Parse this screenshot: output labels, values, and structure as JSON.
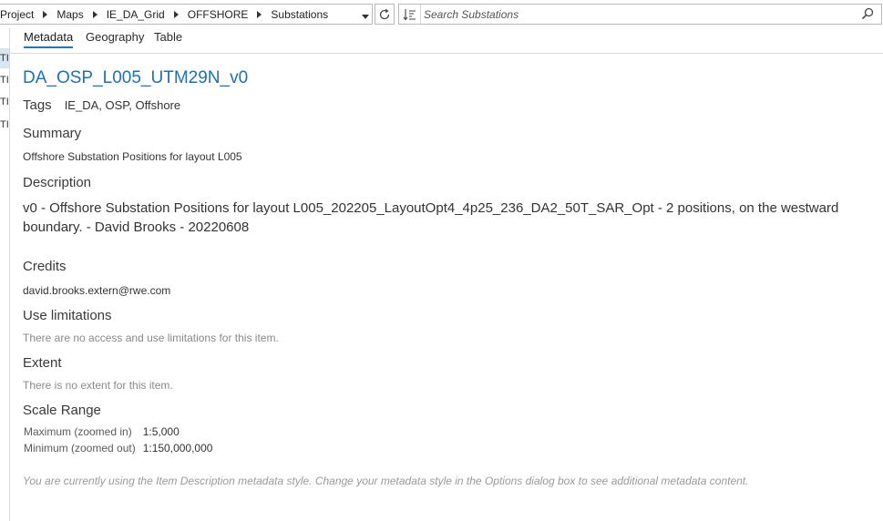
{
  "breadcrumb": {
    "items": [
      "Project",
      "Maps",
      "IE_DA_Grid",
      "OFFSHORE",
      "Substations"
    ]
  },
  "search": {
    "placeholder": "Search Substations"
  },
  "left_strip": {
    "items": [
      "TI",
      "TI",
      "TI",
      "TI"
    ]
  },
  "tabs": [
    {
      "label": "Metadata",
      "active": true
    },
    {
      "label": "Geography",
      "active": false
    },
    {
      "label": "Table",
      "active": false
    }
  ],
  "metadata": {
    "title": "DA_OSP_L005_UTM29N_v0",
    "tags_label": "Tags",
    "tags_value": "IE_DA, OSP, Offshore",
    "summary_label": "Summary",
    "summary_value": "Offshore Substation Positions for layout L005",
    "description_label": "Description",
    "description_value": "v0 - Offshore Substation Positions for layout L005_202205_LayoutOpt4_4p25_236_DA2_50T_SAR_Opt - 2 positions, on the westward boundary. - David Brooks - 20220608",
    "credits_label": "Credits",
    "credits_value": "david.brooks.extern@rwe.com",
    "use_limitations_label": "Use limitations",
    "use_limitations_value": "There are no access and use limitations for this item.",
    "extent_label": "Extent",
    "extent_value": "There is no extent for this item.",
    "scale_range_label": "Scale Range",
    "scale_max_label": "Maximum (zoomed in)",
    "scale_max_value": "1:5,000",
    "scale_min_label": "Minimum (zoomed out)",
    "scale_min_value": "1:150,000,000",
    "footer_note": "You are currently using the Item Description metadata style. Change your metadata style in the Options dialog box to see additional metadata content."
  },
  "colors": {
    "accent": "#1a77c9",
    "title": "#1f6fb5"
  }
}
